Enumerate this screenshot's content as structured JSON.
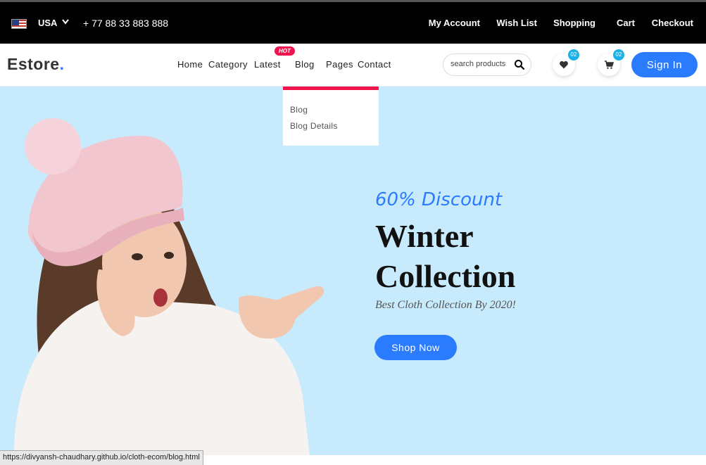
{
  "topbar": {
    "country": "USA",
    "phone": "+ 77 88 33 883 888",
    "links": [
      "My Account",
      "Wish List",
      "Shopping",
      "Cart",
      "Checkout"
    ]
  },
  "navbar": {
    "logo": "Estore",
    "logo_dot": ".",
    "menu": [
      "Home",
      "Category",
      "Latest",
      "Blog",
      "Pages",
      "Contact"
    ],
    "hot_badge": "HOT",
    "search_placeholder": "search products",
    "wishlist_count": "02",
    "cart_count": "02",
    "signin_label": "Sign In"
  },
  "dropdown": {
    "items": [
      "Blog",
      "Blog Details"
    ]
  },
  "hero": {
    "discount": "60% Discount",
    "headline_line1": "Winter",
    "headline_line2": "Collection",
    "subtitle": "Best Cloth Collection By 2020!",
    "cta": "Shop Now"
  },
  "statusbar": {
    "url": "https://divyansh-chaudhary.github.io/cloth-ecom/blog.html"
  },
  "colors": {
    "accent": "#2b7bff",
    "hot": "#f0134d",
    "hero_bg": "#c7eafc",
    "badge": "#1bb0e8"
  }
}
